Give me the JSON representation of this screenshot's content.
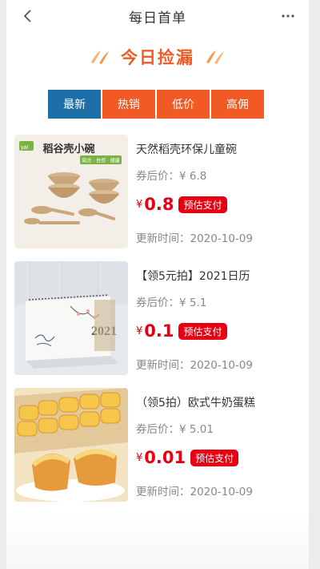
{
  "header": {
    "title": "每日首单"
  },
  "banner": {
    "title": "今日捡漏"
  },
  "tabs": [
    {
      "label": "最新",
      "active": true
    },
    {
      "label": "热销",
      "active": false
    },
    {
      "label": "低价",
      "active": false
    },
    {
      "label": "高佣",
      "active": false
    }
  ],
  "items": [
    {
      "name": "天然稻壳环保儿童碗",
      "coupon_price": "券后价：¥ 6.8",
      "currency": "¥",
      "price": "0.8",
      "tag": "预估支付",
      "updated": "更新时间：2020-10-09",
      "thumb": {
        "badge": "ya!",
        "title": "稻谷壳小碗",
        "subtitle": "简洁 · 自然 · 健康"
      }
    },
    {
      "name": "【领5元拍】2021日历",
      "coupon_price": "券后价：¥ 5.1",
      "currency": "¥",
      "price": "0.1",
      "tag": "预估支付",
      "updated": "更新时间：2020-10-09",
      "thumb": {
        "year": "2021"
      }
    },
    {
      "name": "（领5拍）欧式牛奶蛋糕",
      "coupon_price": "券后价：¥ 5.01",
      "currency": "¥",
      "price": "0.01",
      "tag": "预估支付",
      "updated": "更新时间：2020-10-09",
      "thumb": {}
    }
  ],
  "colors": {
    "accent": "#f15a24",
    "active_tab": "#1c6fa8",
    "price_red": "#e60012"
  },
  "icons": [
    "chevron-left-icon",
    "more-dots-icon",
    "brush-stroke-icon"
  ]
}
